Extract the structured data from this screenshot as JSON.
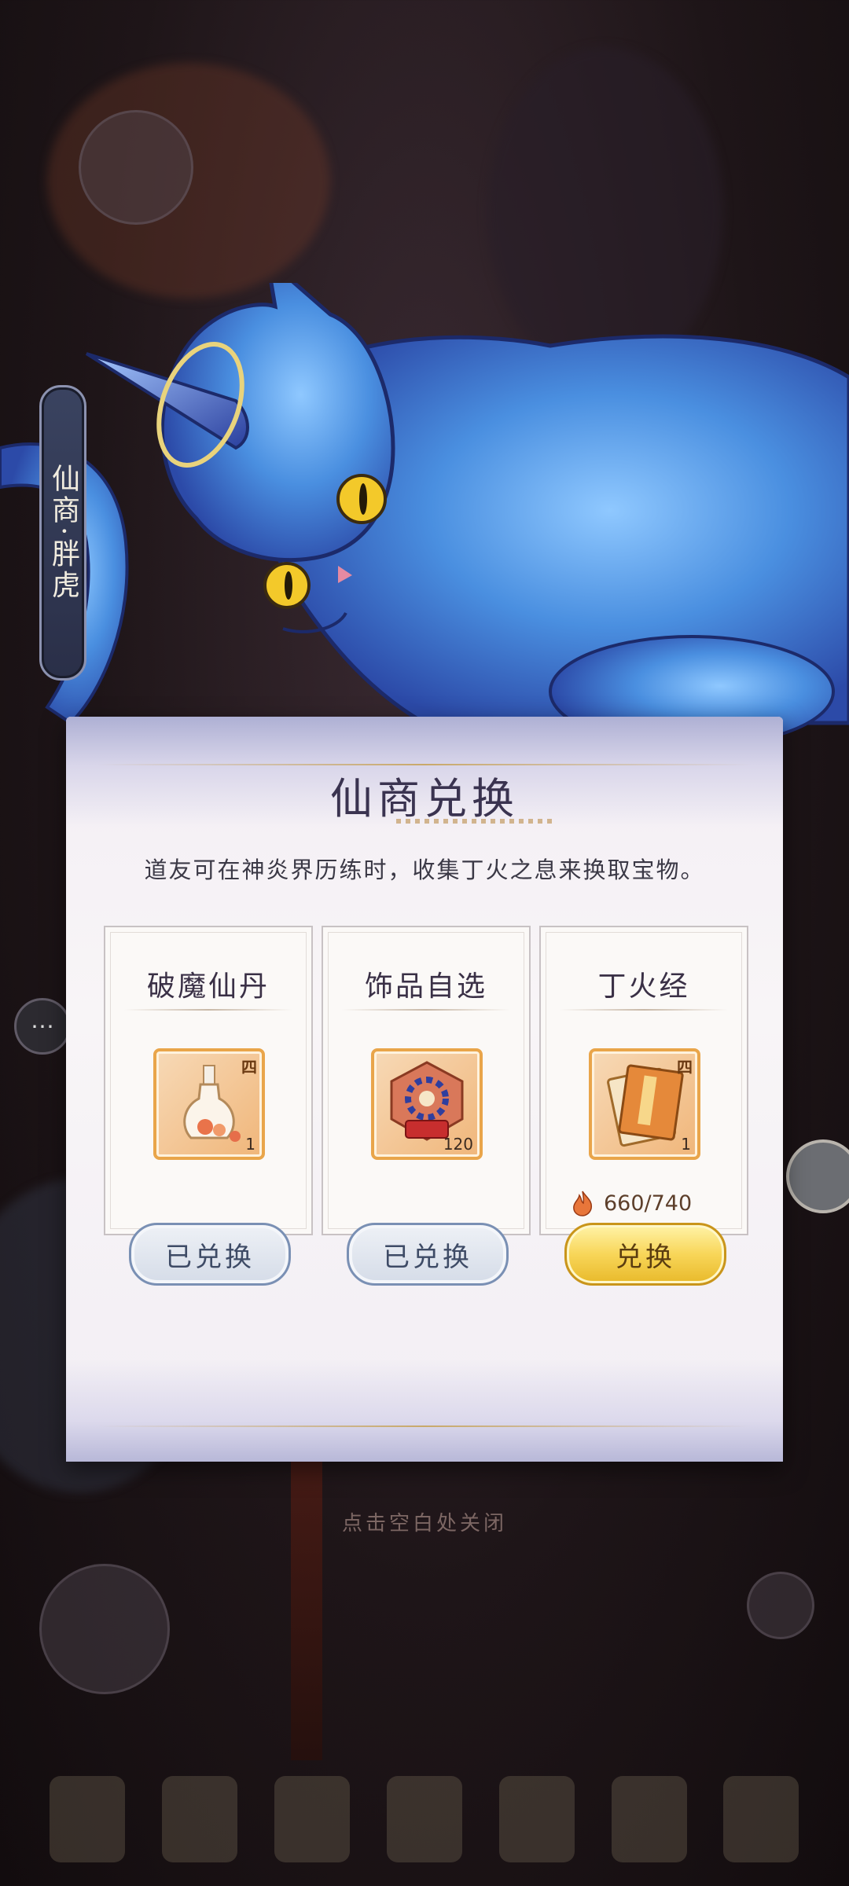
{
  "merchant": {
    "name_tag": "仙商·胖虎"
  },
  "panel": {
    "title": "仙商兑换",
    "description": "道友可在神炎界历练时，收集丁火之息来换取宝物。"
  },
  "items": [
    {
      "name": "破魔仙丹",
      "icon": "potion-flask-icon",
      "tier": "四",
      "quantity": "1",
      "button_label": "已兑换",
      "state": "exchanged"
    },
    {
      "name": "饰品自选",
      "icon": "accessory-chest-icon",
      "tier": "",
      "quantity": "120",
      "button_label": "已兑换",
      "state": "exchanged"
    },
    {
      "name": "丁火经",
      "icon": "scripture-book-icon",
      "tier": "四",
      "quantity": "1",
      "cost": "660/740",
      "cost_icon": "flame-icon",
      "button_label": "兑换",
      "state": "available"
    }
  ],
  "close_hint": "点击空白处关闭",
  "colors": {
    "title": "#3a3350",
    "exchange_button": "#f8d659",
    "exchanged_button_border": "#7a90b4",
    "item_border": "#e9a54a",
    "cat_body": "#4a8fe0"
  }
}
